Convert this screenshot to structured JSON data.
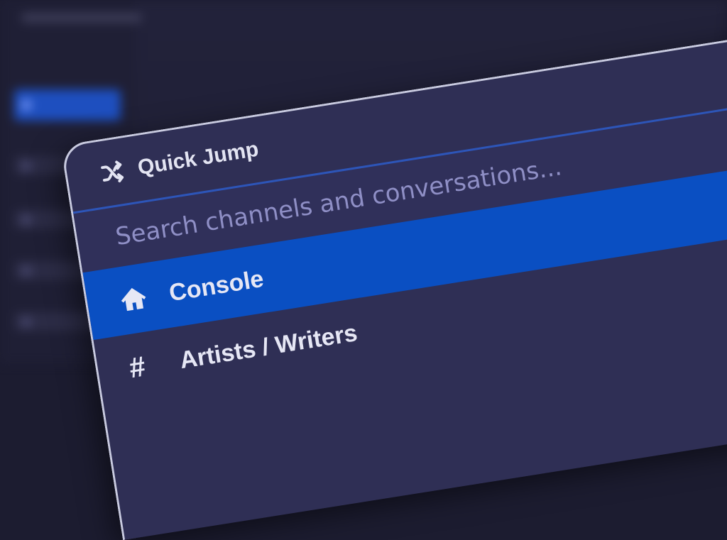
{
  "quick_jump": {
    "title": "Quick Jump",
    "title_icon": "shuffle-icon",
    "search": {
      "placeholder": "Search channels and conversations...",
      "value": ""
    },
    "results": [
      {
        "label": "Console",
        "icon": "home-icon",
        "selected": true
      },
      {
        "label": "Artists / Writers",
        "icon": "hash-icon",
        "selected": false
      }
    ]
  },
  "colors": {
    "panel_bg": "#2f2f55",
    "selected_bg": "#0a4fc2",
    "placeholder": "#8f8fc6",
    "text": "#e6e7f5"
  }
}
